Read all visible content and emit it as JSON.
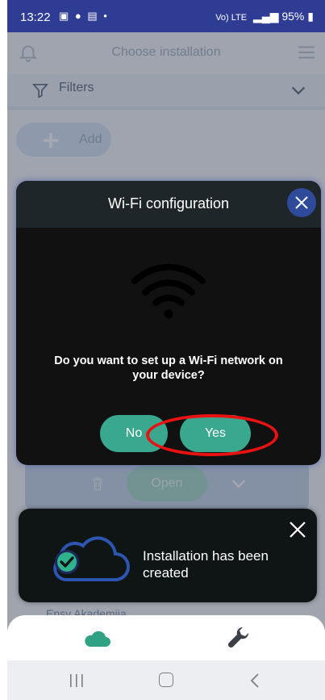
{
  "status_bar": {
    "time": "13:22",
    "notification_icons": [
      "image-icon",
      "chat-icon",
      "messenger-icon",
      "dot-icon"
    ],
    "network_label": "Vo) LTE",
    "battery": "95%"
  },
  "app": {
    "title": "Choose installation",
    "filters_label": "Filters",
    "add_label": "Add",
    "open_label": "Open",
    "installation_name_partial": "Ensy Akademija"
  },
  "dialog": {
    "title": "Wi-Fi configuration",
    "question": "Do you want to set up a Wi-Fi network on your device?",
    "no_label": "No",
    "yes_label": "Yes"
  },
  "toast": {
    "message": "Installation has been created"
  },
  "bottom_nav": {
    "items": [
      "cloud-icon",
      "wrench-icon"
    ]
  },
  "system_nav": {
    "items": [
      "recent-apps-icon",
      "home-icon",
      "back-icon"
    ]
  },
  "colors": {
    "status_bar": "#2f3c94",
    "accent_green": "#3aa88f",
    "highlight_ring": "#e81212",
    "dialog_bg": "#111111",
    "close_blue": "#2f4a9a"
  }
}
